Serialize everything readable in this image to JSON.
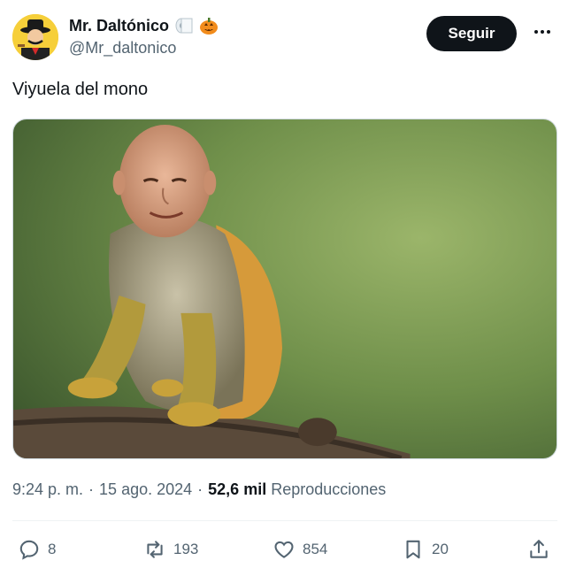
{
  "author": {
    "display_name": "Mr. Daltónico",
    "handle": "@Mr_daltonico",
    "name_emojis": [
      "toilet-paper-emoji",
      "jack-o-lantern-emoji"
    ]
  },
  "follow_button": {
    "label": "Seguir"
  },
  "more_button": {
    "icon": "more-horizontal-icon"
  },
  "tweet": {
    "text": "Viyuela del mono",
    "media_description_icon": "image"
  },
  "meta": {
    "time": "9:24 p. m.",
    "separator": "·",
    "date": "15 ago. 2024",
    "views_count": "52,6 mil",
    "views_label": "Reproducciones"
  },
  "actions": {
    "reply": {
      "icon": "reply-icon",
      "count": "8"
    },
    "retweet": {
      "icon": "retweet-icon",
      "count": "193"
    },
    "like": {
      "icon": "heart-icon",
      "count": "854"
    },
    "bookmark": {
      "icon": "bookmark-icon",
      "count": "20"
    },
    "share": {
      "icon": "share-icon"
    }
  },
  "colors": {
    "text_primary": "#0f1419",
    "text_secondary": "#536471",
    "follow_bg": "#0f1419",
    "border": "#cfd9de"
  }
}
